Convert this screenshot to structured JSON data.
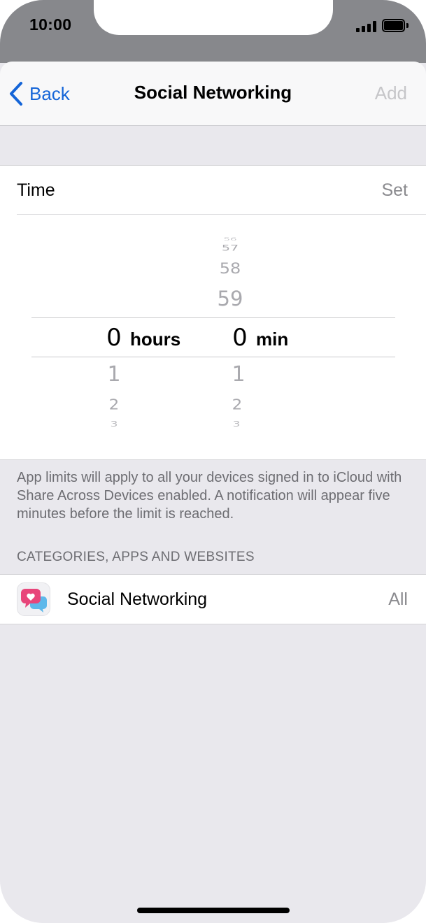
{
  "status_bar": {
    "time": "10:00"
  },
  "nav": {
    "back_label": "Back",
    "title": "Social Networking",
    "add_label": "Add"
  },
  "time_row": {
    "label": "Time",
    "value": "Set"
  },
  "picker": {
    "hours": {
      "selected": "0",
      "unit": "hours",
      "below": [
        "1",
        "2",
        "3"
      ]
    },
    "minutes": {
      "above": [
        "56",
        "57",
        "58",
        "59"
      ],
      "selected": "0",
      "unit": "min",
      "below": [
        "1",
        "2",
        "3"
      ]
    }
  },
  "note": "App limits will apply to all your devices signed in to iCloud with Share Across Devices enabled. A notification will appear five minutes before the limit is reached.",
  "section_header": "CATEGORIES, APPS AND WEBSITES",
  "category": {
    "icon": "social-networking-icon",
    "label": "Social Networking",
    "value": "All"
  },
  "colors": {
    "accent": "#1565d8",
    "disabled": "#c6c6c9",
    "background": "#e9e8ed",
    "status_bar": "#87888c"
  }
}
